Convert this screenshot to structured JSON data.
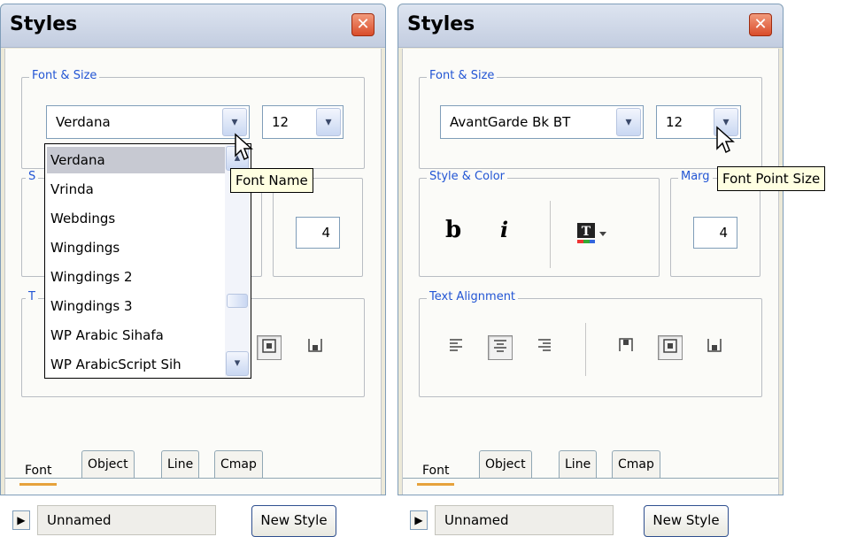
{
  "left": {
    "title": "Styles",
    "close_glyph": "✕",
    "font_size_legend": "Font & Size",
    "font_name": "Verdana",
    "font_size": "12",
    "dropdown_glyph": "▾",
    "font_list": [
      "Verdana",
      "Vrinda",
      "Webdings",
      "Wingdings",
      "Wingdings 2",
      "Wingdings 3",
      "WP Arabic Sihafa",
      "WP ArabicScript Sih"
    ],
    "tooltip": "Font Name",
    "margin_value": "4",
    "hidden_legend_a": "S",
    "hidden_legend_b": "T",
    "tabs": [
      "Font",
      "Object",
      "Line",
      "Cmap"
    ],
    "style_name": "Unnamed",
    "new_style": "New Style",
    "expand_glyph": "▶"
  },
  "right": {
    "title": "Styles",
    "close_glyph": "✕",
    "font_size_legend": "Font & Size",
    "font_name": "AvantGarde Bk BT",
    "font_size": "12",
    "dropdown_glyph": "▾",
    "style_color_legend": "Style & Color",
    "bold_label": "b",
    "italic_label": "i",
    "margin_legend": "Marg",
    "margin_value": "4",
    "tooltip": "Font Point Size",
    "text_alignment_legend": "Text Alignment",
    "tabs": [
      "Font",
      "Object",
      "Line",
      "Cmap"
    ],
    "style_name": "Unnamed",
    "new_style": "New Style",
    "expand_glyph": "▶"
  },
  "icons": {
    "align_left": "≡",
    "align_center": "≡",
    "align_right": "≡",
    "valign_top": "top-align-icon",
    "valign_middle": "middle-align-icon",
    "valign_bottom": "bottom-align-icon"
  },
  "colors": {
    "legend": "#2255d4",
    "tab_active_underline": "#e6a23c",
    "close": "#d94c2a"
  }
}
